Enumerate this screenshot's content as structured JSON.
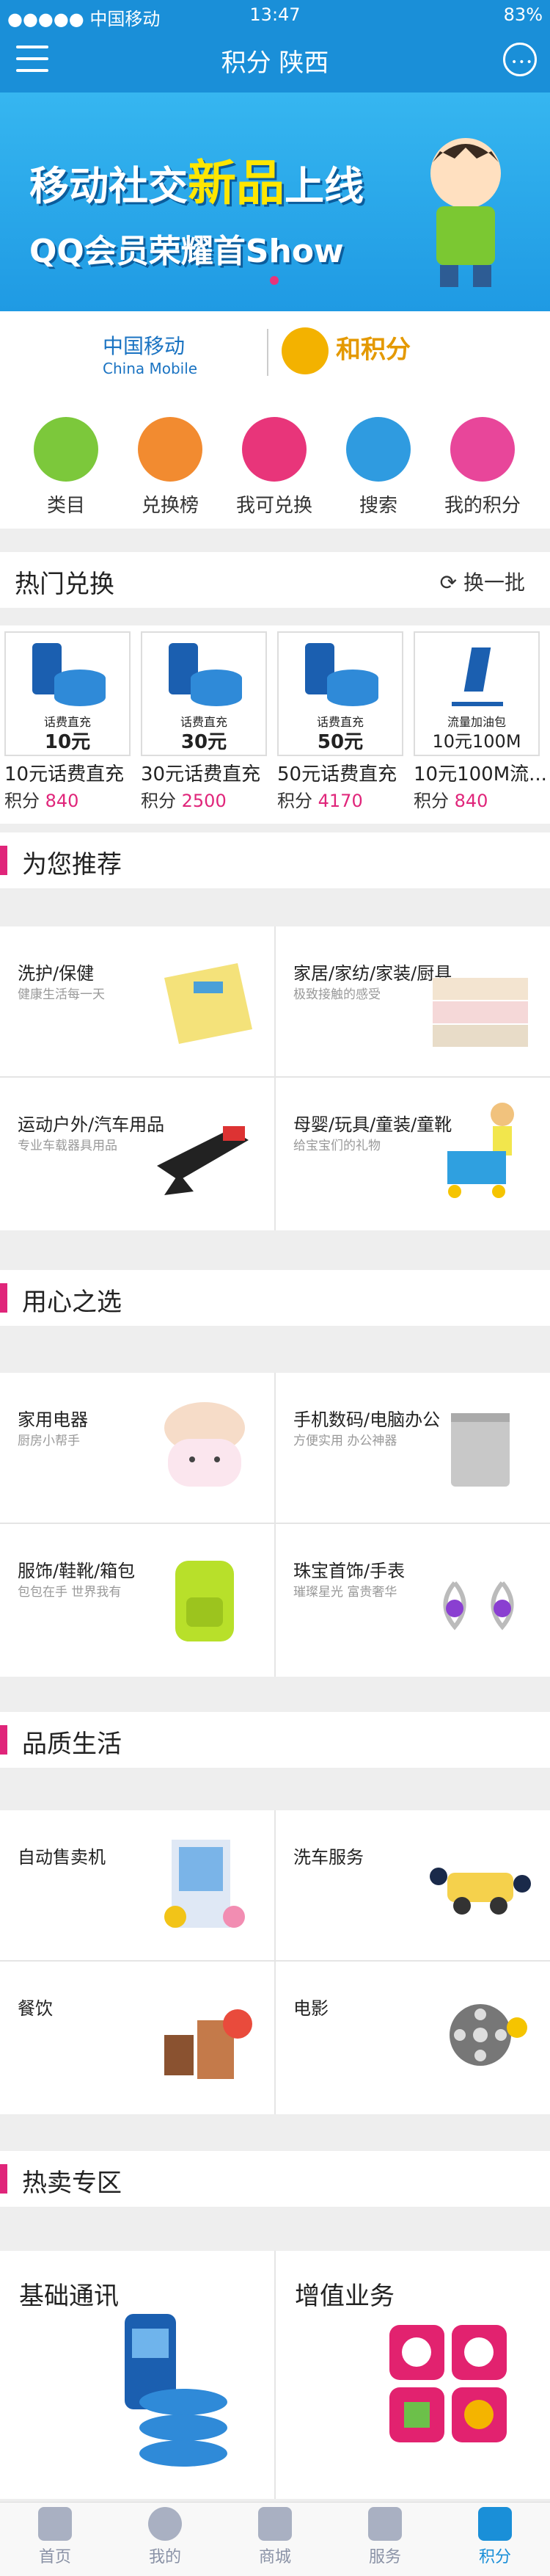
{
  "status_bar": {
    "carrier": "●●●●● 中国移动 ",
    "time": "13:47",
    "battery": "83%"
  },
  "header": {
    "title": "积分  陕西"
  },
  "banner": {
    "line1_prefix": "移动社交",
    "line1_highlight": "新品",
    "line1_suffix": "上线",
    "line2": "QQ会员荣耀首Show"
  },
  "brands": {
    "china_mobile": "中国移动",
    "china_mobile_en": "China Mobile",
    "hejifen": "和积分"
  },
  "categories": [
    {
      "label": "类目",
      "color": "#7cc83b",
      "icon": "list-icon"
    },
    {
      "label": "兑换榜",
      "color": "#f28b30",
      "icon": "gift-icon"
    },
    {
      "label": "我可兑换",
      "color": "#e8357a",
      "icon": "exchange-icon"
    },
    {
      "label": "搜索",
      "color": "#2f9be0",
      "icon": "search-icon"
    },
    {
      "label": "我的积分",
      "color": "#e8469a",
      "icon": "user-icon"
    }
  ],
  "hot": {
    "title": "热门兑换",
    "refresh": "换一批",
    "items": [
      {
        "name": "10元话费直充",
        "points_label": "积分",
        "points": "840",
        "img_text": "话费直充",
        "img_value": "10元"
      },
      {
        "name": "30元话费直充",
        "points_label": "积分",
        "points": "2500",
        "img_text": "话费直充",
        "img_value": "30元"
      },
      {
        "name": "50元话费直充",
        "points_label": "积分",
        "points": "4170",
        "img_text": "话费直充",
        "img_value": "50元"
      },
      {
        "name": "10元100M流...",
        "points_label": "积分",
        "points": "840",
        "img_text": "流量加油包",
        "img_value": "10元100M"
      }
    ]
  },
  "sections": [
    {
      "title": "为您推荐",
      "cells": [
        {
          "title": "洗护/保健",
          "sub": "健康生活每一天"
        },
        {
          "title": "家居/家纺/家装/厨具",
          "sub": "极致接触的感受"
        },
        {
          "title": "运动户外/汽车用品",
          "sub": "专业车载器具用品"
        },
        {
          "title": "母婴/玩具/童装/童靴",
          "sub": "给宝宝们的礼物"
        }
      ]
    },
    {
      "title": "用心之选",
      "cells": [
        {
          "title": "家用电器",
          "sub": "厨房小帮手"
        },
        {
          "title": "手机数码/电脑办公",
          "sub": "方便实用 办公神器"
        },
        {
          "title": "服饰/鞋靴/箱包",
          "sub": "包包在手 世界我有"
        },
        {
          "title": "珠宝首饰/手表",
          "sub": "璀璨星光 富贵奢华"
        }
      ]
    },
    {
      "title": "品质生活",
      "cells": [
        {
          "title": "自动售卖机",
          "sub": ""
        },
        {
          "title": "洗车服务",
          "sub": ""
        },
        {
          "title": "餐饮",
          "sub": ""
        },
        {
          "title": "电影",
          "sub": ""
        }
      ]
    }
  ],
  "hot_zone": {
    "title": "热卖专区",
    "cells": [
      {
        "title": "基础通讯"
      },
      {
        "title": "增值业务"
      }
    ]
  },
  "bottom_nav": [
    {
      "label": "首页",
      "icon": "home-icon"
    },
    {
      "label": "我的",
      "icon": "profile-icon"
    },
    {
      "label": "商城",
      "icon": "cart-icon"
    },
    {
      "label": "服务",
      "icon": "handshake-icon"
    },
    {
      "label": "积分",
      "icon": "points-gift-icon",
      "active": true
    }
  ]
}
